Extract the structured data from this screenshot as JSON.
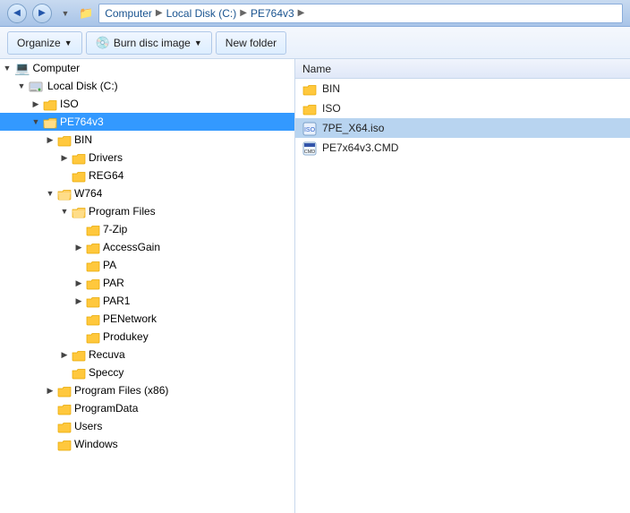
{
  "titlebar": {
    "back_label": "◀",
    "forward_label": "▶",
    "breadcrumbs": [
      {
        "label": "Computer",
        "sep": "▶"
      },
      {
        "label": "Local Disk (C:)",
        "sep": "▶"
      },
      {
        "label": "PE764v3",
        "sep": "▶"
      }
    ]
  },
  "toolbar": {
    "organize_label": "Organize",
    "organize_arrow": "▼",
    "burn_label": "Burn disc image",
    "burn_arrow": "▼",
    "new_folder_label": "New folder"
  },
  "tree": {
    "col_header": "Name",
    "items": [
      {
        "id": "computer",
        "label": "Computer",
        "indent": 0,
        "icon": "💻",
        "expanded": true,
        "selected": false
      },
      {
        "id": "local-disk",
        "label": "Local Disk (C:)",
        "indent": 1,
        "icon": "💾",
        "expanded": true,
        "selected": false
      },
      {
        "id": "iso",
        "label": "ISO",
        "indent": 2,
        "icon": "📁",
        "expanded": false,
        "selected": false,
        "has_children": true
      },
      {
        "id": "pe764v3",
        "label": "PE764v3",
        "indent": 2,
        "icon": "📁",
        "expanded": true,
        "selected": true,
        "has_children": true
      },
      {
        "id": "bin",
        "label": "BIN",
        "indent": 3,
        "icon": "📁",
        "expanded": false,
        "selected": false,
        "has_children": true
      },
      {
        "id": "drivers",
        "label": "Drivers",
        "indent": 4,
        "icon": "📁",
        "expanded": false,
        "selected": false,
        "has_children": true
      },
      {
        "id": "reg64",
        "label": "REG64",
        "indent": 4,
        "icon": "📁",
        "expanded": false,
        "selected": false,
        "has_children": false
      },
      {
        "id": "w764",
        "label": "W764",
        "indent": 3,
        "icon": "📁",
        "expanded": true,
        "selected": false,
        "has_children": true
      },
      {
        "id": "program-files",
        "label": "Program Files",
        "indent": 4,
        "icon": "📁",
        "expanded": true,
        "selected": false,
        "has_children": true
      },
      {
        "id": "7zip",
        "label": "7-Zip",
        "indent": 5,
        "icon": "📁",
        "expanded": false,
        "selected": false,
        "has_children": false
      },
      {
        "id": "accessgain",
        "label": "AccessGain",
        "indent": 5,
        "icon": "📁",
        "expanded": false,
        "selected": false,
        "has_children": true
      },
      {
        "id": "pa",
        "label": "PA",
        "indent": 5,
        "icon": "📁",
        "expanded": false,
        "selected": false,
        "has_children": false
      },
      {
        "id": "par",
        "label": "PAR",
        "indent": 5,
        "icon": "📁",
        "expanded": false,
        "selected": false,
        "has_children": true
      },
      {
        "id": "par1",
        "label": "PAR1",
        "indent": 5,
        "icon": "📁",
        "expanded": false,
        "selected": false,
        "has_children": true
      },
      {
        "id": "penetwork",
        "label": "PENetwork",
        "indent": 5,
        "icon": "📁",
        "expanded": false,
        "selected": false,
        "has_children": false
      },
      {
        "id": "produkey",
        "label": "Produkey",
        "indent": 5,
        "icon": "📁",
        "expanded": false,
        "selected": false,
        "has_children": false
      },
      {
        "id": "recuva",
        "label": "Recuva",
        "indent": 4,
        "icon": "📁",
        "expanded": false,
        "selected": false,
        "has_children": true
      },
      {
        "id": "speccy",
        "label": "Speccy",
        "indent": 4,
        "icon": "📁",
        "expanded": false,
        "selected": false,
        "has_children": false
      },
      {
        "id": "program-files-x86",
        "label": "Program Files (x86)",
        "indent": 3,
        "icon": "📁",
        "expanded": false,
        "selected": false,
        "has_children": true
      },
      {
        "id": "programdata",
        "label": "ProgramData",
        "indent": 3,
        "icon": "📁",
        "expanded": false,
        "selected": false,
        "has_children": false
      },
      {
        "id": "users",
        "label": "Users",
        "indent": 3,
        "icon": "📁",
        "expanded": false,
        "selected": false,
        "has_children": false
      },
      {
        "id": "windows",
        "label": "Windows",
        "indent": 3,
        "icon": "📁",
        "expanded": false,
        "selected": false,
        "has_children": false
      }
    ]
  },
  "files": {
    "col_header": "Name",
    "items": [
      {
        "name": "BIN",
        "type": "folder",
        "selected": false
      },
      {
        "name": "ISO",
        "type": "folder",
        "selected": false
      },
      {
        "name": "7PE_X64.iso",
        "type": "iso",
        "selected": true
      },
      {
        "name": "PE7x64v3.CMD",
        "type": "cmd",
        "selected": false
      }
    ]
  }
}
